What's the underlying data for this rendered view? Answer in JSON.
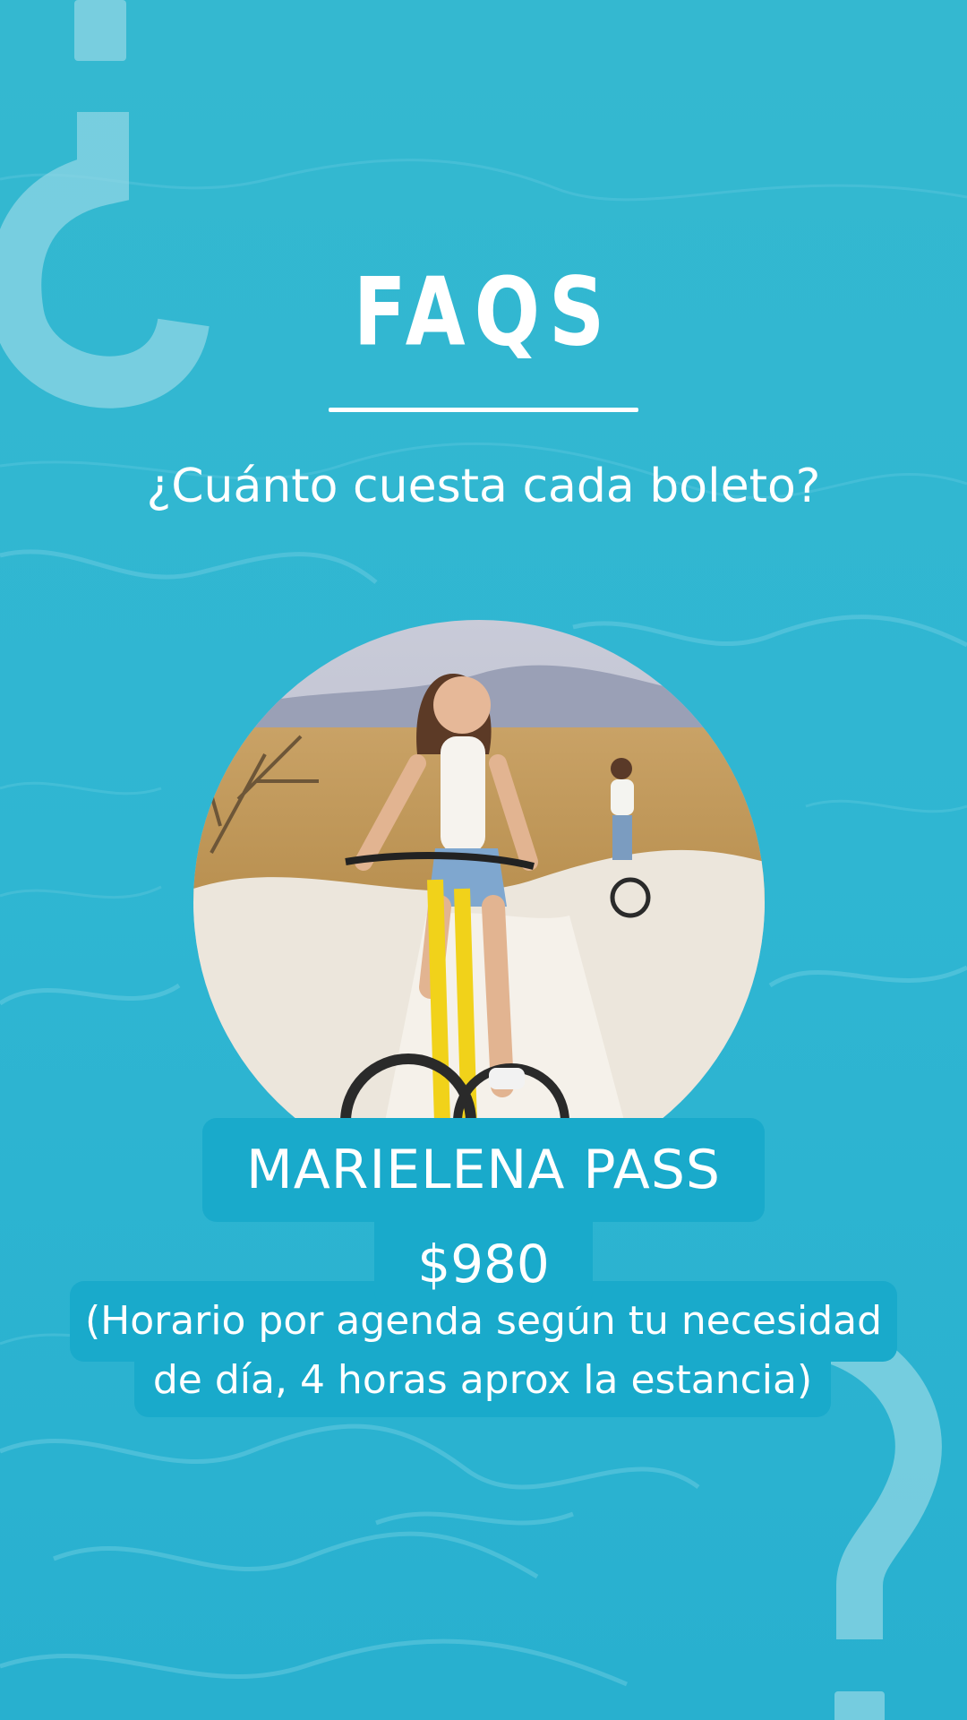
{
  "header": {
    "title": "FAQS"
  },
  "question": "¿Cuánto cuesta cada boleto?",
  "decorations": {
    "top_left": "¿",
    "bottom_right": "?",
    "color": "#8fd6e4"
  },
  "photo": {
    "description_icon": "photo-cyclists"
  },
  "pass": {
    "name": "MARIELENA PASS",
    "price": "$980",
    "note_line1": "(Horario por agenda según tu necesidad",
    "note_line2": "de día, 4 horas aprox la estancia)"
  },
  "colors": {
    "water": "#2fb5cf",
    "tag": "#19aacb",
    "text": "#ffffff"
  }
}
